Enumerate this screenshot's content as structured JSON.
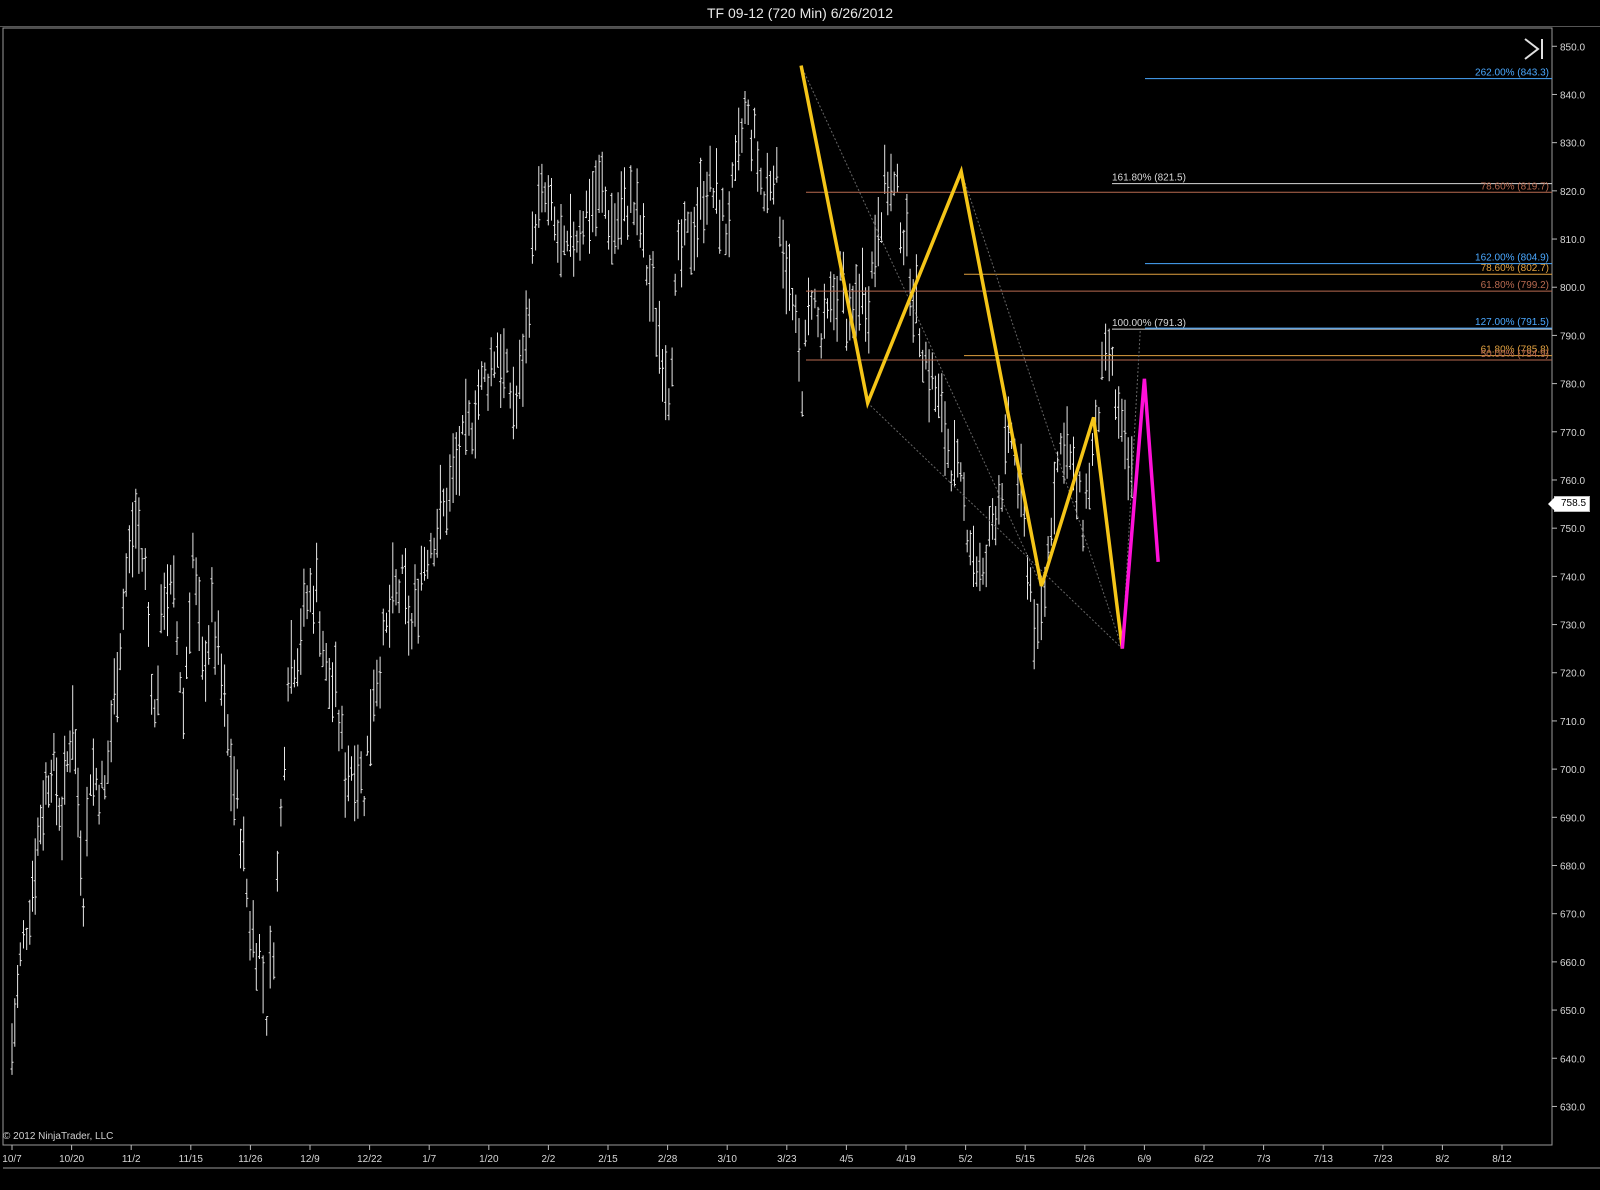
{
  "window": {
    "title": "TF 09-12 (720 Min)  6/26/2012"
  },
  "copyright": "© 2012 NinjaTrader, LLC",
  "controls": {
    "end_button_icon": "play-to-end-icon"
  },
  "colors": {
    "background": "#000000",
    "bars": "#e6e6e6",
    "pattern_main": "#f5c518",
    "pattern_alt": "#ff10d8",
    "fib_blue": "#4aa8ff",
    "fib_brown": "#b86a50",
    "fib_orange": "#e0a040",
    "fib_white": "#d8d8d8"
  },
  "chart_data": {
    "type": "ohlc",
    "instrument": "TF 09-12",
    "interval": "720 Min",
    "last_price": "758.5",
    "ylim": [
      622,
      854
    ],
    "y_ticks": [
      "850.0",
      "840.0",
      "830.0",
      "820.0",
      "810.0",
      "800.0",
      "790.0",
      "780.0",
      "770.0",
      "760.0",
      "750.0",
      "740.0",
      "730.0",
      "720.0",
      "710.0",
      "700.0",
      "690.0",
      "680.0",
      "670.0",
      "660.0",
      "650.0",
      "640.0",
      "630.0"
    ],
    "x_ticks": [
      "10/7",
      "10/20",
      "11/2",
      "11/15",
      "11/26",
      "12/9",
      "12/22",
      "1/7",
      "1/20",
      "2/2",
      "2/15",
      "2/28",
      "3/10",
      "3/23",
      "4/5",
      "4/19",
      "5/2",
      "5/15",
      "5/26",
      "6/9",
      "6/22",
      "7/3",
      "7/13",
      "7/23",
      "8/2",
      "8/12"
    ],
    "price_path": [
      [
        0,
        642
      ],
      [
        7,
        660
      ],
      [
        15,
        672
      ],
      [
        24,
        690
      ],
      [
        33,
        702
      ],
      [
        42,
        690
      ],
      [
        51,
        712
      ],
      [
        60,
        675
      ],
      [
        66,
        700
      ],
      [
        78,
        695
      ],
      [
        86,
        715
      ],
      [
        96,
        740
      ],
      [
        104,
        752
      ],
      [
        112,
        740
      ],
      [
        120,
        710
      ],
      [
        128,
        738
      ],
      [
        136,
        735
      ],
      [
        144,
        712
      ],
      [
        152,
        745
      ],
      [
        160,
        720
      ],
      [
        168,
        732
      ],
      [
        176,
        718
      ],
      [
        184,
        700
      ],
      [
        192,
        688
      ],
      [
        200,
        668
      ],
      [
        208,
        662
      ],
      [
        214,
        650
      ],
      [
        220,
        665
      ],
      [
        226,
        690
      ],
      [
        232,
        722
      ],
      [
        240,
        725
      ],
      [
        248,
        735
      ],
      [
        256,
        738
      ],
      [
        264,
        720
      ],
      [
        272,
        715
      ],
      [
        280,
        700
      ],
      [
        288,
        702
      ],
      [
        296,
        696
      ],
      [
        304,
        718
      ],
      [
        312,
        725
      ],
      [
        320,
        735
      ],
      [
        328,
        738
      ],
      [
        336,
        728
      ],
      [
        344,
        742
      ],
      [
        352,
        748
      ],
      [
        360,
        752
      ],
      [
        368,
        758
      ],
      [
        376,
        765
      ],
      [
        384,
        770
      ],
      [
        392,
        778
      ],
      [
        400,
        782
      ],
      [
        408,
        788
      ],
      [
        416,
        780
      ],
      [
        424,
        775
      ],
      [
        432,
        790
      ],
      [
        440,
        815
      ],
      [
        448,
        818
      ],
      [
        456,
        812
      ],
      [
        464,
        805
      ],
      [
        472,
        810
      ],
      [
        480,
        815
      ],
      [
        488,
        818
      ],
      [
        496,
        820
      ],
      [
        504,
        812
      ],
      [
        512,
        815
      ],
      [
        520,
        818
      ],
      [
        528,
        812
      ],
      [
        536,
        800
      ],
      [
        544,
        790
      ],
      [
        552,
        780
      ],
      [
        560,
        805
      ],
      [
        568,
        810
      ],
      [
        576,
        815
      ],
      [
        584,
        822
      ],
      [
        592,
        818
      ],
      [
        600,
        812
      ],
      [
        608,
        822
      ],
      [
        616,
        836
      ],
      [
        624,
        830
      ],
      [
        632,
        818
      ],
      [
        640,
        826
      ],
      [
        648,
        810
      ],
      [
        656,
        795
      ],
      [
        664,
        780
      ],
      [
        672,
        800
      ],
      [
        680,
        788
      ],
      [
        688,
        795
      ],
      [
        696,
        802
      ],
      [
        704,
        790
      ],
      [
        712,
        800
      ],
      [
        720,
        798
      ],
      [
        728,
        815
      ],
      [
        736,
        822
      ],
      [
        744,
        818
      ],
      [
        752,
        808
      ],
      [
        760,
        795
      ],
      [
        768,
        785
      ],
      [
        776,
        778
      ],
      [
        784,
        770
      ],
      [
        792,
        762
      ],
      [
        800,
        755
      ],
      [
        808,
        745
      ],
      [
        816,
        738
      ],
      [
        824,
        752
      ],
      [
        832,
        760
      ],
      [
        840,
        770
      ],
      [
        848,
        755
      ],
      [
        856,
        738
      ],
      [
        862,
        725
      ],
      [
        868,
        738
      ],
      [
        876,
        760
      ],
      [
        884,
        770
      ],
      [
        892,
        760
      ],
      [
        900,
        752
      ],
      [
        908,
        765
      ],
      [
        916,
        780
      ],
      [
        922,
        786
      ],
      [
        930,
        772
      ],
      [
        938,
        762
      ],
      [
        944,
        758
      ]
    ],
    "pattern_abcd_main": {
      "points": [
        {
          "date": "3/26",
          "price": 846
        },
        {
          "date": "4/10",
          "price": 776
        },
        {
          "date": "5/1",
          "price": 824
        },
        {
          "date": "5/18",
          "price": 738
        },
        {
          "date": "5/28",
          "price": 773
        },
        {
          "date": "6/4",
          "price": 725
        }
      ]
    },
    "pattern_alt": {
      "points": [
        {
          "date": "6/4",
          "price": 725
        },
        {
          "date": "6/9",
          "price": 781
        },
        {
          "date": "6/12",
          "price": 743
        }
      ]
    },
    "fib_levels": [
      {
        "label": "262.00% (843.3)",
        "price": 843.3,
        "color": "blue",
        "span": "short"
      },
      {
        "label": "161.80% (821.5)",
        "price": 821.5,
        "color": "white",
        "span": "mid"
      },
      {
        "label": "78.60% (819.7)",
        "price": 819.7,
        "color": "brown",
        "span": "long"
      },
      {
        "label": "162.00% (804.9)",
        "price": 804.9,
        "color": "blue",
        "span": "short"
      },
      {
        "label": "78.60% (802.7)",
        "price": 802.7,
        "color": "orange",
        "span": "medium"
      },
      {
        "label": "61.80% (799.2)",
        "price": 799.2,
        "color": "brown",
        "span": "long"
      },
      {
        "label": "100.00% (791.3)",
        "price": 791.3,
        "color": "white",
        "span": "mid"
      },
      {
        "label": "127.00% (791.5)",
        "price": 791.5,
        "color": "blue",
        "span": "short"
      },
      {
        "label": "61.80% (785.8)",
        "price": 785.8,
        "color": "orange",
        "span": "medium"
      },
      {
        "label": "50.00% (784.9)",
        "price": 784.9,
        "color": "brown",
        "span": "long"
      }
    ]
  }
}
